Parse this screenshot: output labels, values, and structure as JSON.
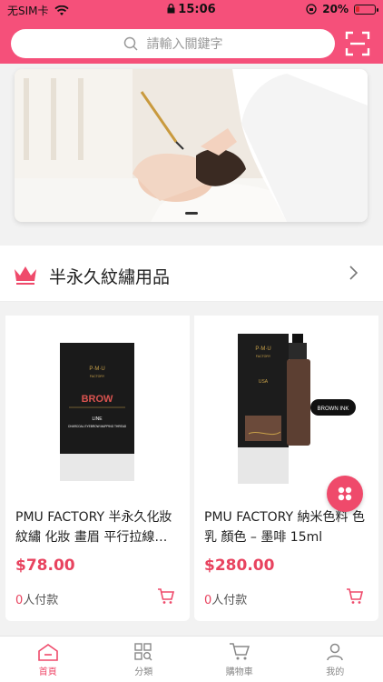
{
  "status_bar": {
    "carrier": "无SIM卡",
    "time": "15:06",
    "battery": "20%",
    "battery_level": 0.2
  },
  "search": {
    "placeholder": "請輸入關鍵字"
  },
  "section": {
    "title": "半永久紋繡用品"
  },
  "products": [
    {
      "name": "PMU FACTORY 半永久化妝紋繡 化妝 畫眉 平行拉線…",
      "price": "$78.00",
      "paid_count": "0",
      "paid_suffix": "人付款",
      "box_logo": "P·M·U",
      "box_sub": "FACTORY",
      "box_title": "BROW",
      "box_line": "LINE",
      "box_desc": "CHARCOAL EYEBROW MAPPING THREAD"
    },
    {
      "name": "PMU FACTORY 納米色料 色乳 顏色 – 墨啡 15ml",
      "price": "$280.00",
      "paid_count": "0",
      "paid_suffix": "人付款",
      "box_logo": "P·M·U",
      "box_sub": "FACTORY",
      "box_country": "USA",
      "box_tag": "BROWN INK"
    }
  ],
  "tabs": [
    {
      "label": "首頁",
      "icon": "home-icon",
      "active": true
    },
    {
      "label": "分類",
      "icon": "category-icon",
      "active": false
    },
    {
      "label": "購物車",
      "icon": "cart-icon",
      "active": false
    },
    {
      "label": "我的",
      "icon": "profile-icon",
      "active": false
    }
  ],
  "colors": {
    "brand": "#f5507a",
    "price": "#e8435f"
  }
}
